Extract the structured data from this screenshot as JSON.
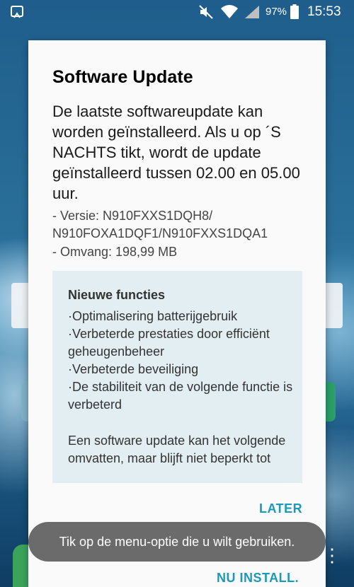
{
  "status_bar": {
    "battery_percent": "97%",
    "time": "15:53",
    "icons": [
      "screenshot-icon",
      "mute-icon",
      "wifi-icon",
      "signal-icon",
      "battery-icon"
    ]
  },
  "dialog": {
    "title": "Software Update",
    "message": "De laatste softwareupdate kan worden geïnstalleerd. Als u op ´S NACHTS tikt, wordt de update geïnstalleerd tussen 02.00 en 05.00 uur.",
    "version_line": " - Versie: N910FXXS1DQH8/ N910FOXA1DQF1/N910FXXS1DQA1",
    "size_line": " - Omvang: 198,99 MB",
    "notes": {
      "heading": "Nieuwe functies",
      "items": [
        "·Optimalisering batterijgebruik",
        "·Verbeterde prestaties door efficiënt geheugenbeheer",
        "·Verbeterde beveiliging",
        "·De stabiliteit van de volgende functie is verbeterd"
      ],
      "footer": "Een software update kan het volgende omvatten, maar blijft niet beperkt tot"
    },
    "buttons": {
      "later": "LATER",
      "install_now": "NU INSTALL."
    }
  },
  "toast": {
    "text": "Tik op de menu-optie die u wilt gebruiken."
  },
  "colors": {
    "accent": "#1a9ab8",
    "notes_background": "#e3eef2",
    "toast_background": "#6b6b6b"
  }
}
